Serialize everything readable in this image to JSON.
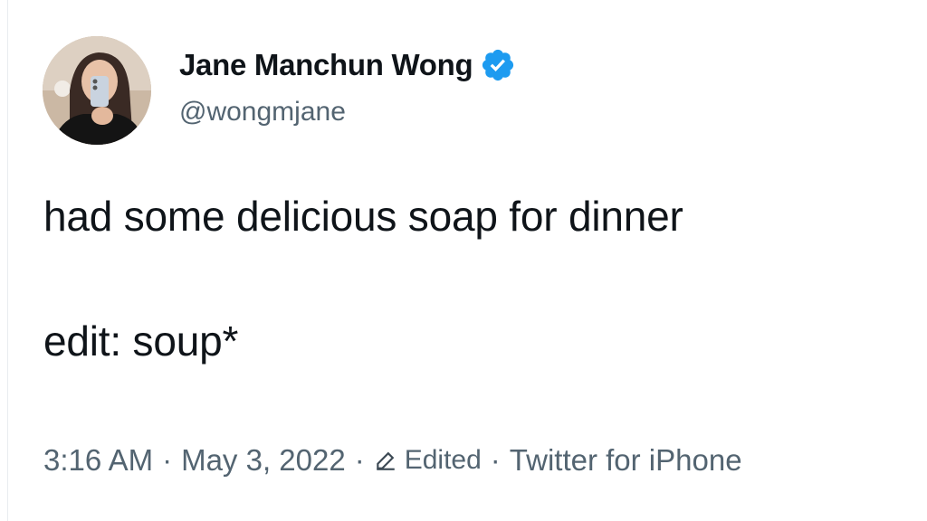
{
  "author": {
    "display_name": "Jane Manchun Wong",
    "handle": "@wongmjane",
    "verified": true,
    "avatar_icon": "profile-photo"
  },
  "tweet": {
    "line_1": "had some delicious soap for dinner",
    "line_2": "edit: soup*"
  },
  "meta": {
    "time": "3:16 AM",
    "separator": "·",
    "date": "May 3, 2022",
    "edited_label": "Edited",
    "source": "Twitter for iPhone"
  },
  "colors": {
    "text_primary": "#0f1419",
    "text_secondary": "#536471",
    "verified_blue": "#1d9bf0"
  }
}
